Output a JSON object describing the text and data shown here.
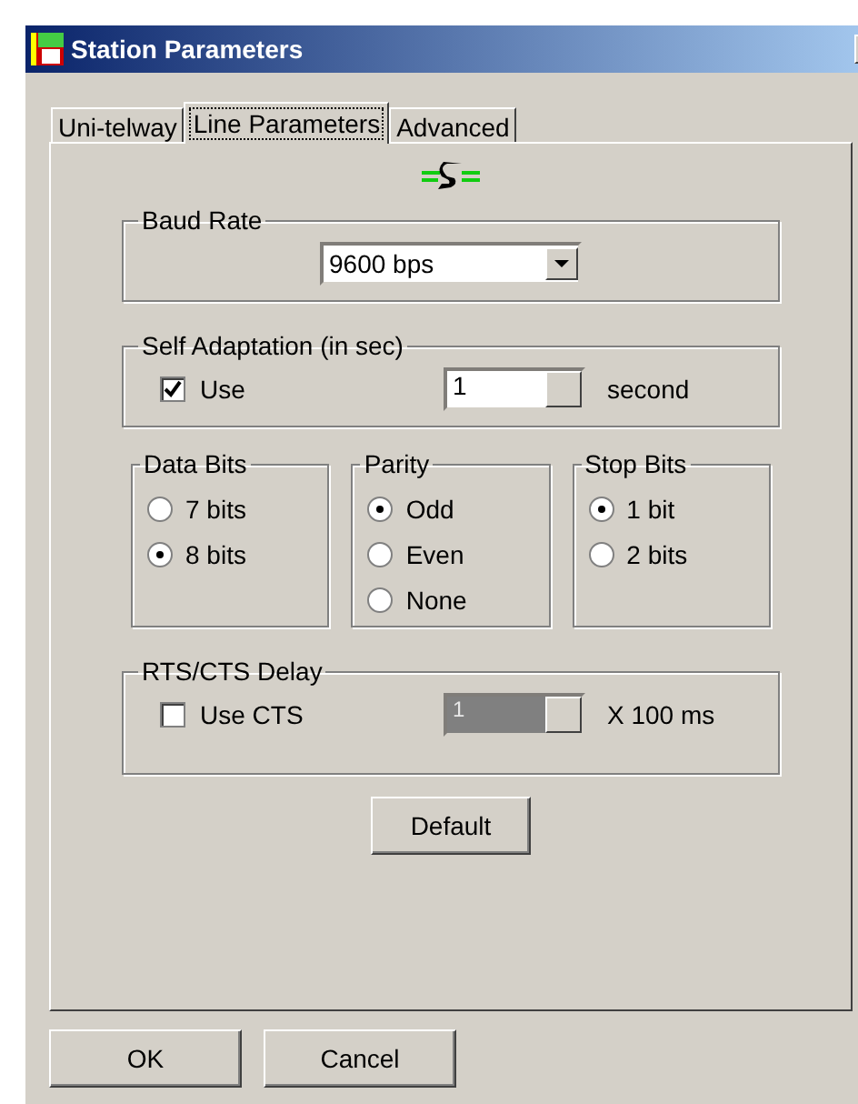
{
  "window": {
    "title": "Station Parameters"
  },
  "tabs": [
    {
      "label": "Uni-telway",
      "selected": false
    },
    {
      "label": "Line Parameters",
      "selected": true
    },
    {
      "label": "Advanced",
      "selected": false
    }
  ],
  "baud_rate": {
    "label": "Baud Rate",
    "value": "9600  bps"
  },
  "self_adaptation": {
    "label": "Self Adaptation (in sec)",
    "use": {
      "label": "Use",
      "checked": true
    },
    "value": "1",
    "disabled": false,
    "unit": "second"
  },
  "option_groups": [
    {
      "label": "Data Bits",
      "options": [
        {
          "label": "7 bits",
          "selected": false
        },
        {
          "label": "8 bits",
          "selected": true
        }
      ]
    },
    {
      "label": "Parity",
      "options": [
        {
          "label": "Odd",
          "selected": true
        },
        {
          "label": "Even",
          "selected": false
        },
        {
          "label": "None",
          "selected": false
        }
      ]
    },
    {
      "label": "Stop Bits",
      "options": [
        {
          "label": "1 bit",
          "selected": true
        },
        {
          "label": "2 bits",
          "selected": false
        }
      ]
    }
  ],
  "rts_cts_delay": {
    "label": "RTS/CTS Delay",
    "use": {
      "label": "Use CTS",
      "checked": false
    },
    "value": "1",
    "disabled": true,
    "unit": "X 100 ms"
  },
  "default_button": "Default",
  "buttons": [
    "OK",
    "Cancel"
  ]
}
